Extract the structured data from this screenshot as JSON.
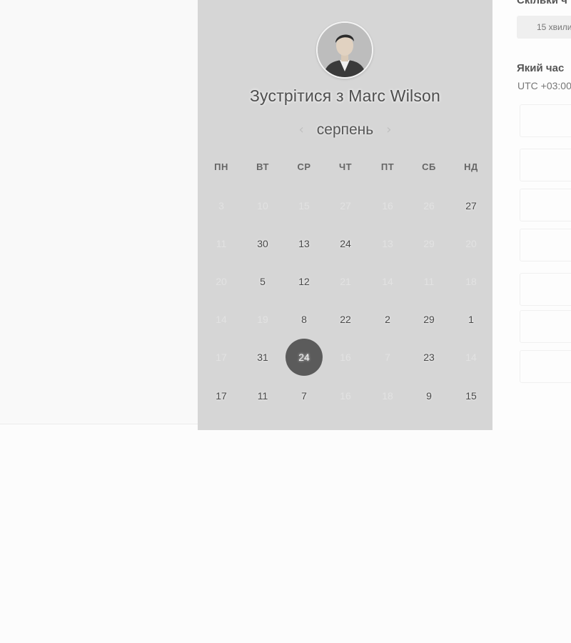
{
  "meeting_title": "Зустрітися з Marc Wilson",
  "month": "серпень",
  "nav": {
    "prev_icon": "‹",
    "next_icon": "›"
  },
  "weekdays": [
    "ПН",
    "ВТ",
    "СР",
    "ЧТ",
    "ПТ",
    "СБ",
    "НД"
  ],
  "weeks": [
    [
      {
        "d": "3",
        "a": false
      },
      {
        "d": "10",
        "a": false
      },
      {
        "d": "15",
        "a": false
      },
      {
        "d": "27",
        "a": false
      },
      {
        "d": "16",
        "a": false
      },
      {
        "d": "26",
        "a": false
      },
      {
        "d": "27",
        "a": true
      }
    ],
    [
      {
        "d": "11",
        "a": false
      },
      {
        "d": "30",
        "a": true
      },
      {
        "d": "13",
        "a": true
      },
      {
        "d": "24",
        "a": true
      },
      {
        "d": "13",
        "a": false
      },
      {
        "d": "29",
        "a": false
      },
      {
        "d": "20",
        "a": false
      }
    ],
    [
      {
        "d": "20",
        "a": false
      },
      {
        "d": "5",
        "a": true
      },
      {
        "d": "12",
        "a": true
      },
      {
        "d": "21",
        "a": false
      },
      {
        "d": "14",
        "a": false
      },
      {
        "d": "11",
        "a": false
      },
      {
        "d": "18",
        "a": false
      }
    ],
    [
      {
        "d": "14",
        "a": false
      },
      {
        "d": "19",
        "a": false
      },
      {
        "d": "8",
        "a": true
      },
      {
        "d": "22",
        "a": true
      },
      {
        "d": "2",
        "a": true
      },
      {
        "d": "29",
        "a": true
      },
      {
        "d": "1",
        "a": true
      }
    ],
    [
      {
        "d": "17",
        "a": false
      },
      {
        "d": "31",
        "a": true
      },
      {
        "d": "24",
        "a": true,
        "selected": true
      },
      {
        "d": "16",
        "a": false
      },
      {
        "d": "7",
        "a": false
      },
      {
        "d": "23",
        "a": true
      },
      {
        "d": "14",
        "a": false
      }
    ],
    [
      {
        "d": "17",
        "a": true
      },
      {
        "d": "11",
        "a": true
      },
      {
        "d": "7",
        "a": true
      },
      {
        "d": "16",
        "a": false
      },
      {
        "d": "18",
        "a": false
      },
      {
        "d": "9",
        "a": true
      },
      {
        "d": "15",
        "a": true
      }
    ]
  ],
  "right": {
    "duration_label": "Скільки ч",
    "duration_value": "15 хвили",
    "time_label": "Який час",
    "timezone": "UTC +03:00"
  },
  "colors": {
    "selected_bg": "#5b5b5b",
    "panel_bg": "#d6d6d6"
  }
}
